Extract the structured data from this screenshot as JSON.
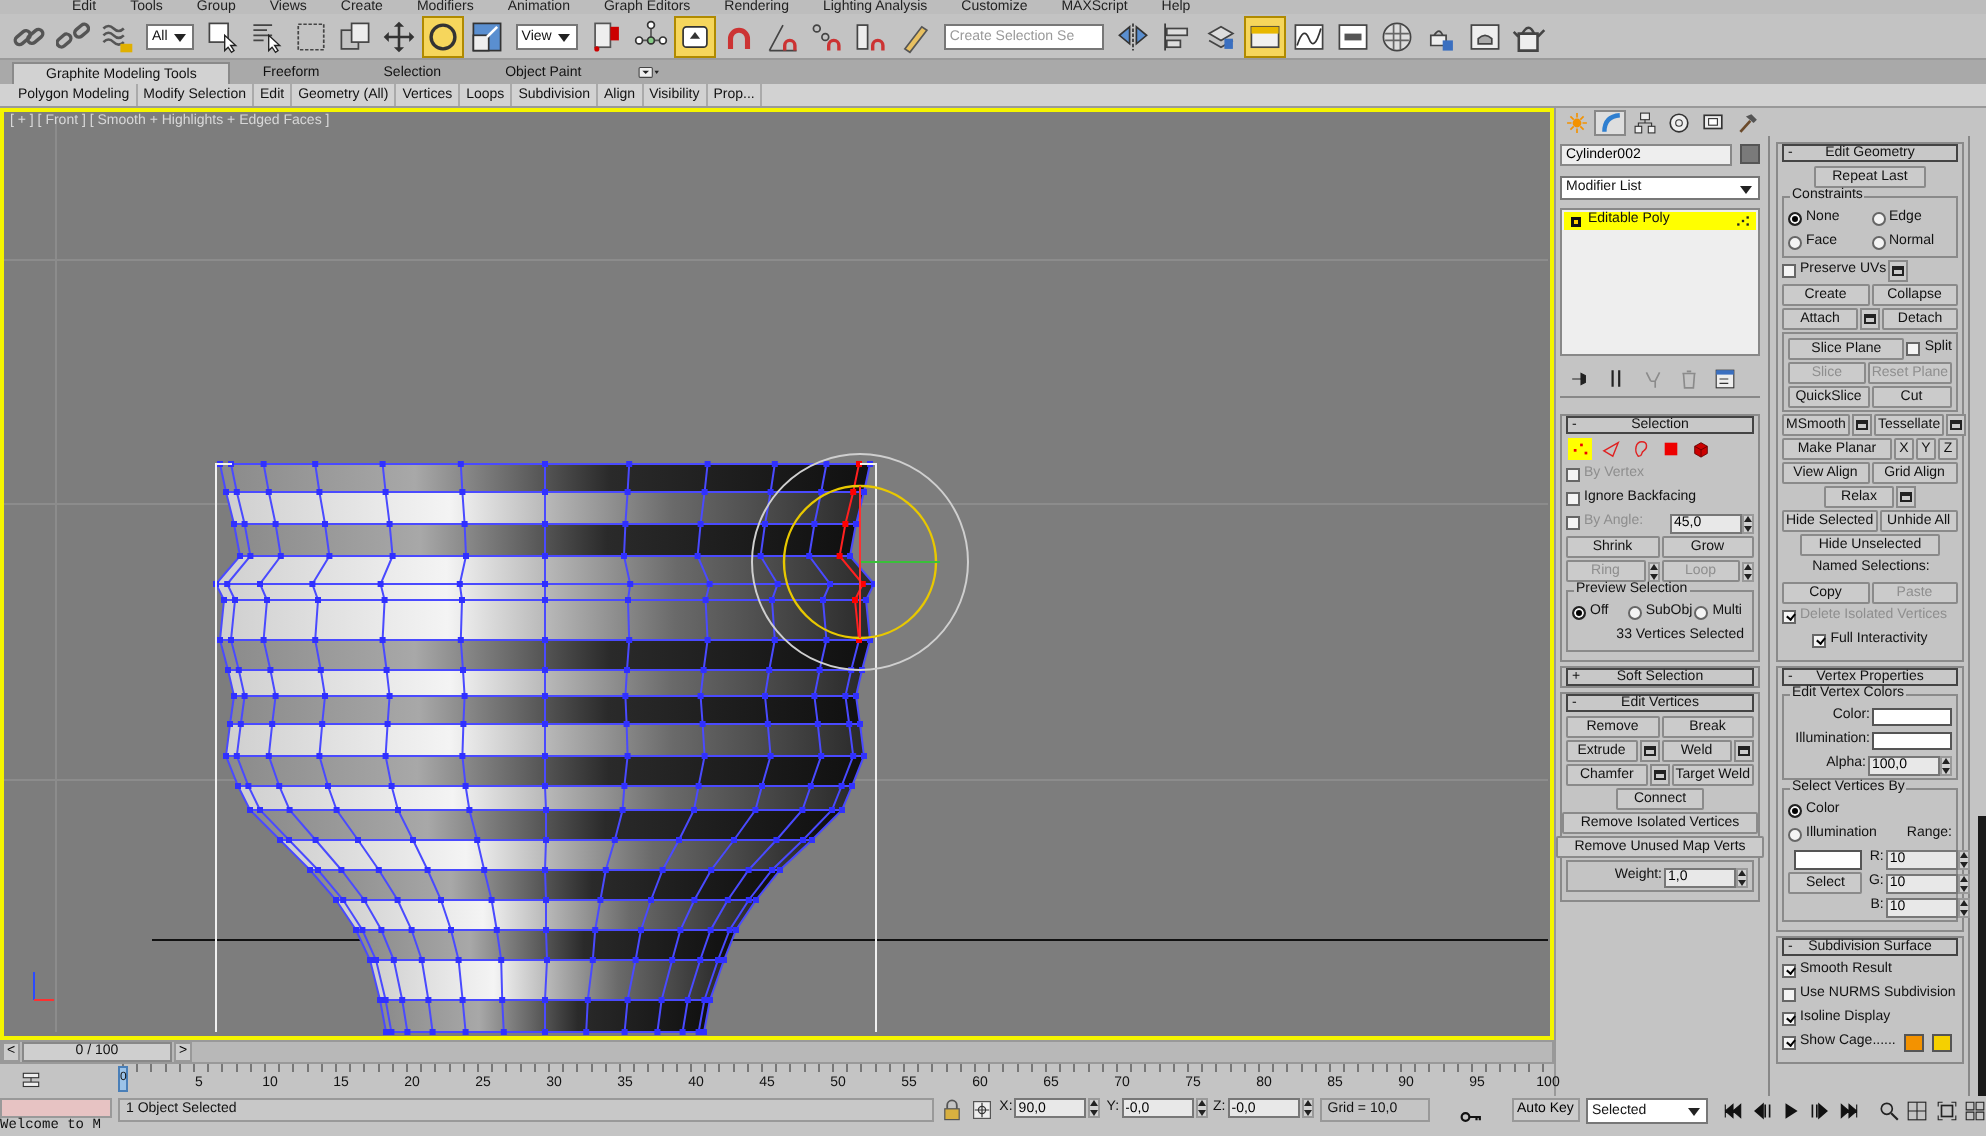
{
  "menu": [
    "Edit",
    "Tools",
    "Group",
    "Views",
    "Create",
    "Modifiers",
    "Animation",
    "Graph Editors",
    "Rendering",
    "Lighting Analysis",
    "Customize",
    "MAXScript",
    "Help"
  ],
  "toolbar": [
    {
      "kind": "tool",
      "selected": false
    },
    {
      "kind": "tool",
      "selected": false
    },
    {
      "kind": "tool",
      "selected": false
    },
    {
      "kind": "dropdown",
      "value": "All"
    },
    {
      "kind": "tool",
      "selected": false
    },
    {
      "kind": "tool",
      "selected": false
    },
    {
      "kind": "tool",
      "selected": false
    },
    {
      "kind": "tool",
      "selected": false
    },
    {
      "kind": "tool",
      "selected": false
    },
    {
      "kind": "tool",
      "selected": true
    },
    {
      "kind": "tool",
      "selected": false
    },
    {
      "kind": "dropdown",
      "value": "View"
    },
    {
      "kind": "tool",
      "selected": false
    },
    {
      "kind": "tool",
      "selected": false
    },
    {
      "kind": "tool",
      "selected": true
    },
    {
      "kind": "tool",
      "selected": false
    },
    {
      "kind": "tool",
      "selected": false
    },
    {
      "kind": "tool",
      "selected": false
    },
    {
      "kind": "tool",
      "selected": false
    },
    {
      "kind": "tool",
      "selected": false
    },
    {
      "kind": "combo",
      "placeholder": "Create Selection Se"
    },
    {
      "kind": "tool",
      "selected": false
    },
    {
      "kind": "tool",
      "selected": false
    },
    {
      "kind": "tool",
      "selected": false
    },
    {
      "kind": "tool",
      "selected": true
    },
    {
      "kind": "tool",
      "selected": false
    },
    {
      "kind": "tool",
      "selected": false
    },
    {
      "kind": "tool",
      "selected": false
    },
    {
      "kind": "tool",
      "selected": false
    },
    {
      "kind": "tool",
      "selected": false
    },
    {
      "kind": "tool",
      "selected": false
    }
  ],
  "ribbon": {
    "tabs": [
      {
        "label": "Graphite Modeling Tools",
        "selected": true
      },
      {
        "label": "Freeform",
        "selected": false
      },
      {
        "label": "Selection",
        "selected": false
      },
      {
        "label": "Object Paint",
        "selected": false
      }
    ],
    "panels": [
      "Polygon Modeling",
      "Modify Selection",
      "Edit",
      "Geometry (All)",
      "Vertices",
      "Loops",
      "Subdivision",
      "Align",
      "Visibility",
      "Prop..."
    ]
  },
  "viewport": {
    "label": "[ + ] [ Front ] [ Smooth + Highlights + Edged Faces ]",
    "active": true
  },
  "command_panel": {
    "tabs": [
      {
        "selected": false
      },
      {
        "selected": true
      },
      {
        "selected": false
      },
      {
        "selected": false
      },
      {
        "selected": false
      },
      {
        "selected": false
      }
    ],
    "object_name": "Cylinder002",
    "object_swatch": {
      "color": "#7a7a7a"
    },
    "modifier_list": "Modifier List",
    "stack": [
      {
        "label": "Editable Poly",
        "selected": true
      }
    ],
    "stack_tools": [
      {
        "disabled": false
      },
      {
        "disabled": false
      },
      {
        "disabled": true
      },
      {
        "disabled": true
      },
      {
        "disabled": false
      }
    ],
    "left": [
      {
        "sign": "-",
        "title": "Selection",
        "rows": [
          {
            "kind": "subobjects",
            "items": [
              {
                "selected": true
              },
              {
                "selected": false
              },
              {
                "selected": false
              },
              {
                "selected": false
              },
              {
                "selected": false
              }
            ]
          },
          {
            "kind": "row",
            "items": [
              {
                "kind": "check",
                "label": "By Vertex",
                "checked": false,
                "disabled": true
              }
            ]
          },
          {
            "kind": "row",
            "items": [
              {
                "kind": "check",
                "label": "Ignore Backfacing",
                "checked": false,
                "disabled": false
              }
            ]
          },
          {
            "kind": "row",
            "items": [
              {
                "kind": "check",
                "label": "By Angle:",
                "checked": false,
                "disabled": true
              },
              {
                "kind": "spinner",
                "value": "45,0"
              }
            ]
          },
          {
            "kind": "row",
            "items": [
              {
                "kind": "button",
                "label": "Shrink",
                "disabled": false
              },
              {
                "kind": "button",
                "label": "Grow",
                "disabled": false
              }
            ]
          },
          {
            "kind": "row",
            "items": [
              {
                "kind": "button",
                "label": "Ring",
                "disabled": true
              },
              {
                "kind": "spin",
                "disabled": false
              },
              {
                "kind": "button",
                "label": "Loop",
                "disabled": true
              },
              {
                "kind": "spin",
                "disabled": false
              }
            ]
          },
          {
            "kind": "group",
            "title": "Preview Selection",
            "rows": [
              {
                "kind": "row",
                "items": [
                  {
                    "kind": "radio",
                    "label": "Off",
                    "selected": true
                  },
                  {
                    "kind": "radio",
                    "label": "SubObj",
                    "selected": false
                  },
                  {
                    "kind": "radio",
                    "label": "Multi",
                    "selected": false
                  }
                ]
              },
              {
                "kind": "row",
                "items": [
                  {
                    "kind": "status",
                    "text": "33 Vertices Selected"
                  }
                ]
              }
            ]
          }
        ]
      },
      {
        "sign": "+",
        "title": "Soft Selection"
      },
      {
        "sign": "-",
        "title": "Edit Vertices",
        "rows": [
          {
            "kind": "row",
            "items": [
              {
                "kind": "button",
                "label": "Remove",
                "disabled": false
              },
              {
                "kind": "button",
                "label": "Break",
                "disabled": false
              }
            ]
          },
          {
            "kind": "row",
            "items": [
              {
                "kind": "button",
                "label": "Extrude",
                "disabled": false
              },
              {
                "kind": "settings",
                "disabled": false
              },
              {
                "kind": "button",
                "label": "Weld",
                "disabled": false
              },
              {
                "kind": "settings",
                "disabled": false
              }
            ]
          },
          {
            "kind": "row",
            "items": [
              {
                "kind": "button",
                "label": "Chamfer",
                "disabled": false
              },
              {
                "kind": "settings",
                "disabled": false
              },
              {
                "kind": "button",
                "label": "Target Weld",
                "disabled": false
              }
            ]
          },
          {
            "kind": "row",
            "items": [
              {
                "kind": "button",
                "label": "Connect",
                "disabled": false
              }
            ]
          },
          {
            "kind": "row",
            "items": [
              {
                "kind": "button",
                "label": "Remove Isolated Vertices",
                "disabled": false
              }
            ]
          },
          {
            "kind": "row",
            "items": [
              {
                "kind": "button",
                "label": "Remove Unused Map Verts",
                "disabled": false
              }
            ]
          },
          {
            "kind": "group",
            "rows": [
              {
                "kind": "row",
                "items": [
                  {
                    "kind": "spinner",
                    "label": "Weight:",
                    "value": "1,0"
                  }
                ]
              }
            ]
          }
        ]
      }
    ],
    "right": [
      {
        "sign": "-",
        "title": "Edit Geometry",
        "rows": [
          {
            "kind": "row",
            "items": [
              {
                "kind": "button",
                "label": "Repeat Last",
                "disabled": false
              }
            ]
          },
          {
            "kind": "group",
            "title": "Constraints",
            "rows": [
              {
                "kind": "row",
                "items": [
                  {
                    "kind": "radio",
                    "label": "None",
                    "selected": true
                  },
                  {
                    "kind": "radio",
                    "label": "Edge",
                    "selected": false
                  }
                ]
              },
              {
                "kind": "row",
                "items": [
                  {
                    "kind": "radio",
                    "label": "Face",
                    "selected": false
                  },
                  {
                    "kind": "radio",
                    "label": "Normal",
                    "selected": false
                  }
                ]
              }
            ]
          },
          {
            "kind": "row",
            "items": [
              {
                "kind": "check",
                "label": "Preserve UVs",
                "checked": false,
                "disabled": false
              },
              {
                "kind": "settings",
                "disabled": false
              }
            ]
          },
          {
            "kind": "row",
            "items": [
              {
                "kind": "button",
                "label": "Create",
                "disabled": false
              },
              {
                "kind": "button",
                "label": "Collapse",
                "disabled": false
              }
            ]
          },
          {
            "kind": "row",
            "items": [
              {
                "kind": "button",
                "label": "Attach",
                "disabled": false
              },
              {
                "kind": "settings",
                "disabled": false
              },
              {
                "kind": "button",
                "label": "Detach",
                "disabled": false
              }
            ]
          },
          {
            "kind": "group",
            "rows": [
              {
                "kind": "row",
                "items": [
                  {
                    "kind": "button",
                    "label": "Slice Plane",
                    "disabled": false
                  },
                  {
                    "kind": "check",
                    "label": "Split",
                    "checked": false,
                    "disabled": false
                  }
                ]
              },
              {
                "kind": "row",
                "items": [
                  {
                    "kind": "button",
                    "label": "Slice",
                    "disabled": true
                  },
                  {
                    "kind": "button",
                    "label": "Reset Plane",
                    "disabled": true
                  }
                ]
              },
              {
                "kind": "row",
                "items": [
                  {
                    "kind": "button",
                    "label": "QuickSlice",
                    "disabled": false
                  },
                  {
                    "kind": "button",
                    "label": "Cut",
                    "disabled": false
                  }
                ]
              }
            ]
          },
          {
            "kind": "row",
            "items": [
              {
                "kind": "button",
                "label": "MSmooth",
                "disabled": false
              },
              {
                "kind": "settings",
                "disabled": false
              },
              {
                "kind": "button",
                "label": "Tessellate",
                "disabled": false
              },
              {
                "kind": "settings",
                "disabled": false
              }
            ]
          },
          {
            "kind": "row",
            "items": [
              {
                "kind": "button",
                "label": "Make Planar",
                "disabled": false
              },
              {
                "kind": "button",
                "label": "X",
                "disabled": false
              },
              {
                "kind": "button",
                "label": "Y",
                "disabled": false
              },
              {
                "kind": "button",
                "label": "Z",
                "disabled": false
              }
            ]
          },
          {
            "kind": "row",
            "items": [
              {
                "kind": "button",
                "label": "View Align",
                "disabled": false
              },
              {
                "kind": "button",
                "label": "Grid Align",
                "disabled": false
              }
            ]
          },
          {
            "kind": "row",
            "items": [
              {
                "kind": "button",
                "label": "Relax",
                "disabled": false
              },
              {
                "kind": "settings",
                "disabled": false
              }
            ]
          },
          {
            "kind": "row",
            "items": [
              {
                "kind": "button",
                "label": "Hide Selected",
                "disabled": false
              },
              {
                "kind": "button",
                "label": "Unhide All",
                "disabled": false
              }
            ]
          },
          {
            "kind": "row",
            "items": [
              {
                "kind": "button",
                "label": "Hide Unselected",
                "disabled": false
              }
            ]
          },
          {
            "kind": "row",
            "items": [
              {
                "kind": "text",
                "text": "Named Selections:"
              }
            ]
          },
          {
            "kind": "row",
            "items": [
              {
                "kind": "button",
                "label": "Copy",
                "disabled": false
              },
              {
                "kind": "button",
                "label": "Paste",
                "disabled": true
              }
            ]
          },
          {
            "kind": "row",
            "items": [
              {
                "kind": "check",
                "label": "Delete Isolated Vertices",
                "checked": true,
                "disabled": true
              }
            ]
          },
          {
            "kind": "row",
            "items": [
              {
                "kind": "check",
                "label": "Full Interactivity",
                "checked": true,
                "disabled": false
              }
            ]
          }
        ]
      },
      {
        "sign": "-",
        "title": "Vertex Properties",
        "rows": [
          {
            "kind": "group",
            "title": "Edit Vertex Colors",
            "rows": [
              {
                "kind": "row",
                "items": [
                  {
                    "kind": "swatch",
                    "label": "Color:",
                    "color": "#ffffff"
                  }
                ]
              },
              {
                "kind": "row",
                "items": [
                  {
                    "kind": "swatch",
                    "label": "Illumination:",
                    "color": "#ffffff"
                  }
                ]
              },
              {
                "kind": "row",
                "items": [
                  {
                    "kind": "spinner",
                    "label": "Alpha:",
                    "value": "100,0"
                  }
                ]
              }
            ]
          },
          {
            "kind": "group",
            "title": "Select Vertices By",
            "rows": [
              {
                "kind": "row",
                "items": [
                  {
                    "kind": "radio",
                    "label": "Color",
                    "selected": true
                  }
                ]
              },
              {
                "kind": "row",
                "items": [
                  {
                    "kind": "radio",
                    "label": "Illumination",
                    "selected": false
                  },
                  {
                    "kind": "text",
                    "text": "Range:"
                  }
                ]
              },
              {
                "kind": "columns",
                "columns": [
                  [
                    {
                      "kind": "row",
                      "items": [
                        {
                          "kind": "swatch",
                          "color": "#ffffff"
                        }
                      ]
                    },
                    {
                      "kind": "row",
                      "items": [
                        {
                          "kind": "button",
                          "label": "Select",
                          "disabled": false
                        }
                      ]
                    }
                  ],
                  [
                    {
                      "kind": "row",
                      "items": [
                        {
                          "kind": "spinner",
                          "label": "R:",
                          "value": "10"
                        }
                      ]
                    },
                    {
                      "kind": "row",
                      "items": [
                        {
                          "kind": "spinner",
                          "label": "G:",
                          "value": "10"
                        }
                      ]
                    },
                    {
                      "kind": "row",
                      "items": [
                        {
                          "kind": "spinner",
                          "label": "B:",
                          "value": "10"
                        }
                      ]
                    }
                  ]
                ]
              }
            ]
          }
        ]
      },
      {
        "sign": "-",
        "title": "Subdivision Surface",
        "rows": [
          {
            "kind": "row",
            "items": [
              {
                "kind": "check",
                "label": "Smooth Result",
                "checked": true,
                "disabled": false
              }
            ]
          },
          {
            "kind": "row",
            "items": [
              {
                "kind": "check",
                "label": "Use NURMS Subdivision",
                "checked": false,
                "disabled": false
              }
            ]
          },
          {
            "kind": "row",
            "items": [
              {
                "kind": "check",
                "label": "Isoline Display",
                "checked": true,
                "disabled": false
              }
            ]
          },
          {
            "kind": "row",
            "items": [
              {
                "kind": "check",
                "label": "Show Cage......",
                "checked": true,
                "disabled": false
              },
              {
                "kind": "swatch",
                "color": "#f39200"
              },
              {
                "kind": "swatch",
                "color": "#f5d000"
              }
            ]
          }
        ]
      }
    ]
  },
  "time_slider": {
    "prev": "<",
    "position": "0 / 100",
    "next": ">",
    "level": 0
  },
  "track_bar": {
    "current": "0",
    "labels": [
      "5",
      "10",
      "15",
      "20",
      "25",
      "30",
      "35",
      "40",
      "45",
      "50",
      "55",
      "60",
      "65",
      "70",
      "75",
      "80",
      "85",
      "90",
      "95",
      "100"
    ]
  },
  "status_bar": {
    "prompt": "Welcome to M",
    "message": "1 Object Selected",
    "coords": [
      {
        "label": "X:",
        "value": "90,0"
      },
      {
        "label": "Y:",
        "value": "-0,0"
      },
      {
        "label": "Z:",
        "value": "-0,0"
      }
    ],
    "grid": "Grid = 10,0",
    "auto_key": {
      "label": "Auto Key",
      "on": false
    },
    "key_filter": "Selected"
  }
}
